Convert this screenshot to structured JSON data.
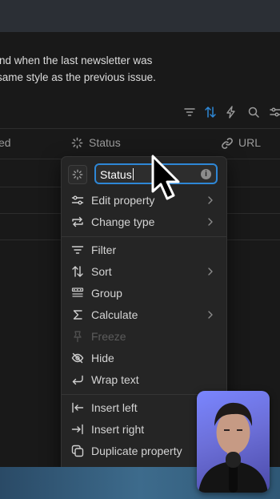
{
  "page": {
    "description_line1": "ind when the last newsletter was",
    "description_line2": " same style as the previous issue."
  },
  "toolbar": {
    "icons": [
      "filter-icon",
      "sort-icon",
      "automation-icon",
      "search-icon",
      "settings-icon"
    ],
    "sort_active_color": "#2e87d6"
  },
  "columns": [
    {
      "label": "ed",
      "icon": "none"
    },
    {
      "label": "Status",
      "icon": "status-icon"
    },
    {
      "label": "URL",
      "icon": "link-icon"
    }
  ],
  "menu": {
    "property_name": "Status",
    "items": [
      {
        "label": "Edit property",
        "icon": "sliders-icon",
        "submenu": true,
        "disabled": false
      },
      {
        "label": "Change type",
        "icon": "change-type-icon",
        "submenu": true,
        "disabled": false
      },
      {
        "label": "Filter",
        "icon": "filter-icon",
        "submenu": false,
        "disabled": false
      },
      {
        "label": "Sort",
        "icon": "sort-icon",
        "submenu": true,
        "disabled": false
      },
      {
        "label": "Group",
        "icon": "group-icon",
        "submenu": false,
        "disabled": false
      },
      {
        "label": "Calculate",
        "icon": "sigma-icon",
        "submenu": true,
        "disabled": false
      },
      {
        "label": "Freeze",
        "icon": "pin-icon",
        "submenu": false,
        "disabled": true
      },
      {
        "label": "Hide",
        "icon": "eye-off-icon",
        "submenu": false,
        "disabled": false
      },
      {
        "label": "Wrap text",
        "icon": "wrap-icon",
        "submenu": false,
        "disabled": false
      },
      {
        "label": "Insert left",
        "icon": "insert-left-icon",
        "submenu": false,
        "disabled": false
      },
      {
        "label": "Insert right",
        "icon": "insert-right-icon",
        "submenu": false,
        "disabled": false
      },
      {
        "label": "Duplicate property",
        "icon": "duplicate-icon",
        "submenu": false,
        "disabled": false
      }
    ]
  },
  "colors": {
    "background": "#191919",
    "menu_bg": "#252525",
    "focus_ring": "#2e87d6"
  }
}
